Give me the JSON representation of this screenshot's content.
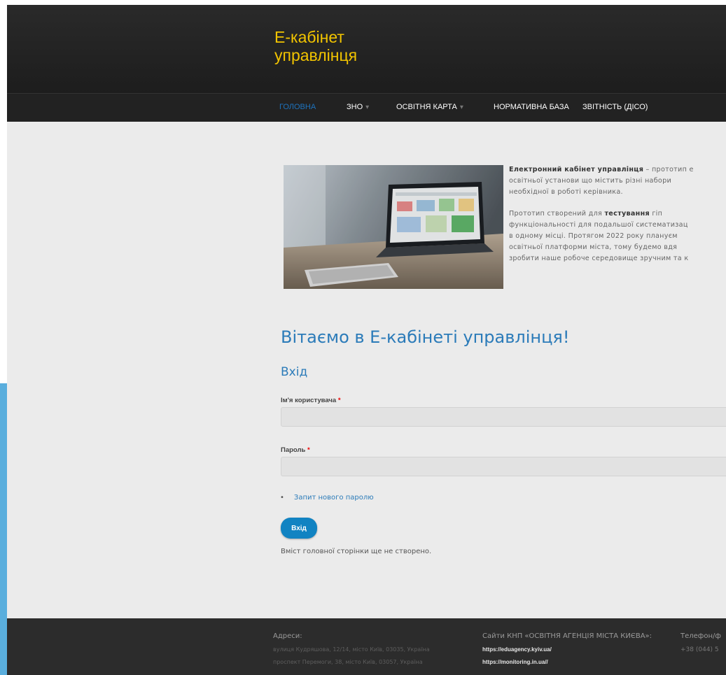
{
  "header": {
    "site_name_line1": "Е-кабінет",
    "site_name_line2": "управлінця"
  },
  "nav": {
    "items": [
      {
        "label": "ГОЛОВНА",
        "active": true,
        "dropdown": false
      },
      {
        "label": "ЗНО",
        "active": false,
        "dropdown": true
      },
      {
        "label": "ОСВІТНЯ КАРТА",
        "active": false,
        "dropdown": true
      },
      {
        "label": "НОРМАТИВНА БАЗА",
        "active": false,
        "dropdown": false
      },
      {
        "label": "ЗВІТНІСТЬ (ДІСО)",
        "active": false,
        "dropdown": false
      }
    ],
    "dropdown_glyph": "▾"
  },
  "intro": {
    "p1_bold": "Електронний кабінет управлінця",
    "p1_line1_rest": " – прототип е",
    "p1_line2": "освітньої установи що містить різні набори",
    "p1_line3": "необхідної в роботі керівника.",
    "p2_line1_pre": "Прототип створений для ",
    "p2_line1_bold": "тестування",
    "p2_line1_post": " гіп",
    "p2_line2": "функціональності для подальшої систематизац",
    "p2_line3": "в одному місці. Протягом 2022 року плануєм",
    "p2_line4": "освітньої платформи міста, тому будемо вдя",
    "p2_line5": "зробити наше робоче середовище зручним та к"
  },
  "main": {
    "welcome_title": "Вітаємо в Е-кабінеті управлінця!",
    "login_heading": "Вхід",
    "username_label": "Ім'я користувача",
    "password_label": "Пароль",
    "required_marker": "*",
    "username_value": "",
    "password_value": "",
    "reset_link": "Запит нового паролю",
    "bullet": "•",
    "submit_label": "Вхід",
    "empty_message": "Вміст головної сторінки ще не створено."
  },
  "footer": {
    "address_title": "Адреси:",
    "address_1": "вулиця Кудряшова, 12/14, місто Київ, 03035, Україна",
    "address_2": "проспект Перемоги, 38, місто Київ, 03057, Україна",
    "sites_title": "Сайти КНП «ОСВІТНЯ АГЕНЦІЯ МІСТА КИЄВА»:",
    "site_1": "https://eduagency.kyiv.ua/",
    "site_2": "https://monitoring.in.ua//",
    "phone_title": "Телефон/ф",
    "phone_value": "+38 (044) 5"
  },
  "colors": {
    "accent_blue": "#2b7bb9",
    "brand_yellow": "#f2c400",
    "button_blue": "#1183c2",
    "left_accent": "#5aaedd"
  },
  "icons": {
    "dropdown": "chevron-down-icon"
  }
}
